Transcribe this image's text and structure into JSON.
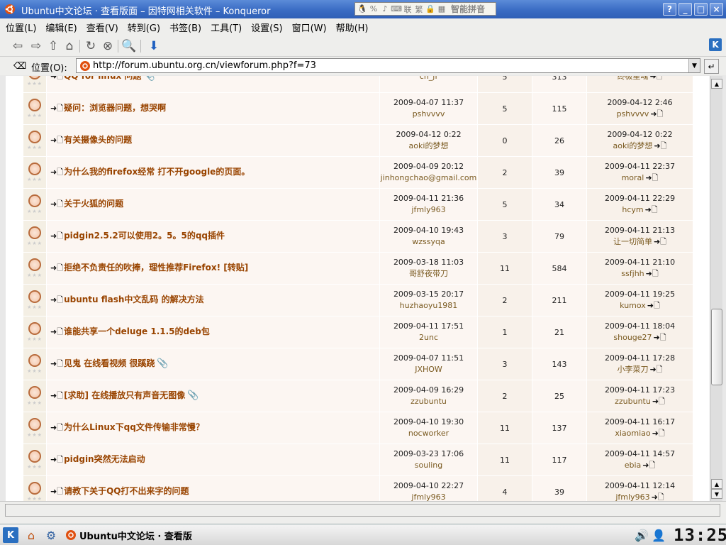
{
  "window": {
    "title": "Ubuntu中文论坛 · 查看版面 – 因特网相关软件 – Konqueror",
    "ime_label": "智能拼音",
    "ime_segments": [
      "联",
      "繁"
    ],
    "controls": [
      "?",
      "_",
      "□",
      "×"
    ]
  },
  "menubar": [
    "位置(L)",
    "编辑(E)",
    "查看(V)",
    "转到(G)",
    "书签(B)",
    "工具(T)",
    "设置(S)",
    "窗口(W)",
    "帮助(H)"
  ],
  "toolbar": {
    "icons": [
      "back-icon",
      "forward-icon",
      "up-icon",
      "home-icon",
      "reload-icon",
      "stop-icon",
      "zoom-icon",
      "download-icon"
    ]
  },
  "location": {
    "label": "位置(O):",
    "url": "http://forum.ubuntu.org.cn/viewforum.php?f=73"
  },
  "topics": [
    {
      "title": "QQ for linux 问题",
      "attachment": true,
      "author_date": "",
      "author": "ch_jf",
      "replies": "5",
      "views": "313",
      "last_date": "",
      "last_user": "终极星魂"
    },
    {
      "title": "疑问：浏览器问题，想哭啊",
      "attachment": false,
      "author_date": "2009-04-07 11:37",
      "author": "pshvvvv",
      "replies": "5",
      "views": "115",
      "last_date": "2009-04-12 2:46",
      "last_user": "pshvvvv"
    },
    {
      "title": "有关摄像头的问题",
      "attachment": false,
      "author_date": "2009-04-12 0:22",
      "author": "aoki的梦想",
      "replies": "0",
      "views": "26",
      "last_date": "2009-04-12 0:22",
      "last_user": "aoki的梦想"
    },
    {
      "title": "为什么我的firefox经常 打不开google的页面。",
      "attachment": false,
      "author_date": "2009-04-09 20:12",
      "author": "jinhongchao@gmail.com",
      "replies": "2",
      "views": "39",
      "last_date": "2009-04-11 22:37",
      "last_user": "moral"
    },
    {
      "title": "关于火狐的问题",
      "attachment": false,
      "author_date": "2009-04-11 21:36",
      "author": "jfmly963",
      "replies": "5",
      "views": "34",
      "last_date": "2009-04-11 22:29",
      "last_user": "hcym"
    },
    {
      "title": "pidgin2.5.2可以使用2。5。5的qq插件",
      "attachment": false,
      "author_date": "2009-04-10 19:43",
      "author": "wzssyqa",
      "replies": "3",
      "views": "79",
      "last_date": "2009-04-11 21:13",
      "last_user": "让一切简单"
    },
    {
      "title": "拒绝不负责任的吹捧，理性推荐Firefox! [转贴]",
      "attachment": false,
      "author_date": "2009-03-18 11:03",
      "author": "哥舒夜带刀",
      "replies": "11",
      "views": "584",
      "last_date": "2009-04-11 21:10",
      "last_user": "ssfjhh"
    },
    {
      "title": "ubuntu flash中文乱码 的解决方法",
      "attachment": false,
      "author_date": "2009-03-15 20:17",
      "author": "huzhaoyu1981",
      "replies": "2",
      "views": "211",
      "last_date": "2009-04-11 19:25",
      "last_user": "kumox"
    },
    {
      "title": "谁能共享一个deluge 1.1.5的deb包",
      "attachment": false,
      "author_date": "2009-04-11 17:51",
      "author": "2unc",
      "replies": "1",
      "views": "21",
      "last_date": "2009-04-11 18:04",
      "last_user": "shouge27"
    },
    {
      "title": "见鬼 在线看视频 很蹊跷",
      "attachment": true,
      "author_date": "2009-04-07 11:51",
      "author": "JXHOW",
      "replies": "3",
      "views": "143",
      "last_date": "2009-04-11 17:28",
      "last_user": "小李菜刀"
    },
    {
      "title": "[求助] 在线播放只有声音无图像",
      "attachment": true,
      "author_date": "2009-04-09 16:29",
      "author": "zzubuntu",
      "replies": "2",
      "views": "25",
      "last_date": "2009-04-11 17:23",
      "last_user": "zzubuntu"
    },
    {
      "title": "为什么Linux下qq文件传输非常慢？",
      "attachment": false,
      "author_date": "2009-04-10 19:30",
      "author": "nocworker",
      "replies": "11",
      "views": "137",
      "last_date": "2009-04-11 16:17",
      "last_user": "xiaomiao"
    },
    {
      "title": "pidgin突然无法启动",
      "attachment": false,
      "author_date": "2009-03-23 17:06",
      "author": "souling",
      "replies": "11",
      "views": "117",
      "last_date": "2009-04-11 14:57",
      "last_user": "ebia"
    },
    {
      "title": "请教下关于QQ打不出来字的问题",
      "attachment": false,
      "author_date": "2009-04-10 22:27",
      "author": "jfmly963",
      "replies": "4",
      "views": "39",
      "last_date": "2009-04-11 12:14",
      "last_user": "jfmly963"
    }
  ],
  "taskbar": {
    "task_label": "Ubuntu中文论坛 · 查看版",
    "clock": "13:25"
  },
  "colors": {
    "title_gradient_top": "#5b8bd8",
    "topic_link": "#994400",
    "row_bg": "#fcf6f2"
  }
}
